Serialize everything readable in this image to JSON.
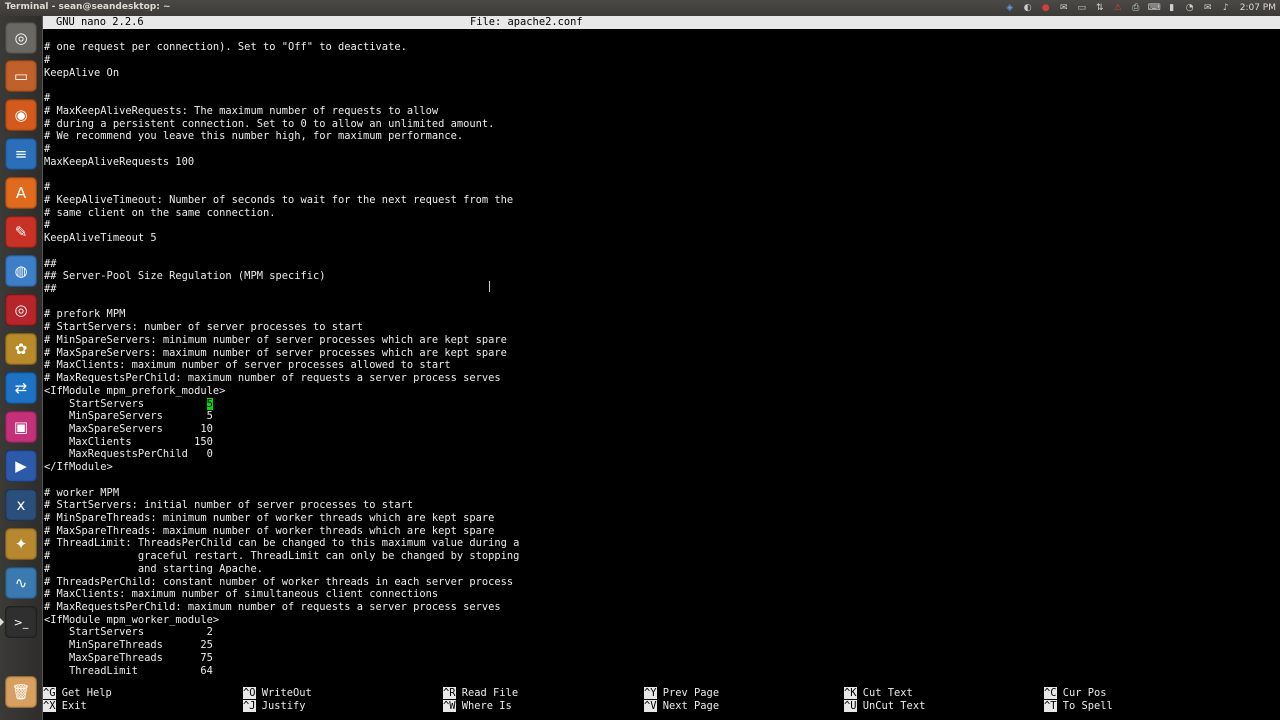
{
  "panel": {
    "window_title": "Terminal - sean@seandesktop: ~",
    "clock": "2:07 PM",
    "tray_icons": [
      "dropbox-icon",
      "notify-icon",
      "chat-icon",
      "mail-icon",
      "display-icon",
      "network-icon",
      "alert-icon",
      "printer-icon",
      "keyboard-icon",
      "battery-icon",
      "chat-bubble-icon",
      "mail-envelope-icon",
      "volume-icon"
    ]
  },
  "launcher": {
    "items": [
      {
        "name": "dash-icon",
        "bg": "#6a6862",
        "glyph": "◎"
      },
      {
        "name": "files-icon",
        "bg": "#c0602a",
        "glyph": "▭"
      },
      {
        "name": "firefox-icon",
        "bg": "#d35a1c",
        "glyph": "◉"
      },
      {
        "name": "writer-icon",
        "bg": "#2b6fb8",
        "glyph": "≡"
      },
      {
        "name": "software-center-icon",
        "bg": "#e06a1e",
        "glyph": "A"
      },
      {
        "name": "editor-icon",
        "bg": "#c83226",
        "glyph": "✎"
      },
      {
        "name": "chromium-icon",
        "bg": "#3d7ec8",
        "glyph": "◍"
      },
      {
        "name": "disc-burner-icon",
        "bg": "#b5252a",
        "glyph": "◎"
      },
      {
        "name": "games-icon",
        "bg": "#b88a2a",
        "glyph": "✿"
      },
      {
        "name": "teamviewer-icon",
        "bg": "#1e72c4",
        "glyph": "⇄"
      },
      {
        "name": "camera-icon",
        "bg": "#c4307a",
        "glyph": "▣"
      },
      {
        "name": "media-player-icon",
        "bg": "#2d5aa8",
        "glyph": "▶"
      },
      {
        "name": "xbmc-icon",
        "bg": "#2a4f7a",
        "glyph": "x"
      },
      {
        "name": "paint-icon",
        "bg": "#b88830",
        "glyph": "✦"
      },
      {
        "name": "system-monitor-icon",
        "bg": "#3a7ab0",
        "glyph": "∿"
      },
      {
        "name": "terminal-icon",
        "bg": "#2f2f2f",
        "glyph": ">_"
      },
      {
        "name": "trash-icon",
        "bg": "#d8a060",
        "glyph": "🗑"
      }
    ]
  },
  "nano": {
    "version": "GNU nano 2.2.6",
    "file_label": "File: apache2.conf",
    "lines": [
      "# one request per connection). Set to \"Off\" to deactivate.",
      "#",
      "KeepAlive On",
      "",
      "#",
      "# MaxKeepAliveRequests: The maximum number of requests to allow",
      "# during a persistent connection. Set to 0 to allow an unlimited amount.",
      "# We recommend you leave this number high, for maximum performance.",
      "#",
      "MaxKeepAliveRequests 100",
      "",
      "#",
      "# KeepAliveTimeout: Number of seconds to wait for the next request from the",
      "# same client on the same connection.",
      "#",
      "KeepAliveTimeout 5",
      "",
      "##",
      "## Server-Pool Size Regulation (MPM specific)",
      "##",
      "",
      "# prefork MPM",
      "# StartServers: number of server processes to start",
      "# MinSpareServers: minimum number of server processes which are kept spare",
      "# MaxSpareServers: maximum number of server processes which are kept spare",
      "# MaxClients: maximum number of server processes allowed to start",
      "# MaxRequestsPerChild: maximum number of requests a server process serves",
      "<IfModule mpm_prefork_module>",
      "    StartServers          5",
      "    MinSpareServers       5",
      "    MaxSpareServers      10",
      "    MaxClients          150",
      "    MaxRequestsPerChild   0",
      "</IfModule>",
      "",
      "# worker MPM",
      "# StartServers: initial number of server processes to start",
      "# MinSpareThreads: minimum number of worker threads which are kept spare",
      "# MaxSpareThreads: maximum number of worker threads which are kept spare",
      "# ThreadLimit: ThreadsPerChild can be changed to this maximum value during a",
      "#              graceful restart. ThreadLimit can only be changed by stopping",
      "#              and starting Apache.",
      "# ThreadsPerChild: constant number of worker threads in each server process",
      "# MaxClients: maximum number of simultaneous client connections",
      "# MaxRequestsPerChild: maximum number of requests a server process serves",
      "<IfModule mpm_worker_module>",
      "    StartServers          2",
      "    MinSpareThreads      25",
      "    MaxSpareThreads      75",
      "    ThreadLimit          64"
    ],
    "cursor_line": 28,
    "cursor_col": 26,
    "shortcuts": [
      {
        "key": "^G",
        "label": "Get Help"
      },
      {
        "key": "^O",
        "label": "WriteOut"
      },
      {
        "key": "^R",
        "label": "Read File"
      },
      {
        "key": "^Y",
        "label": "Prev Page"
      },
      {
        "key": "^K",
        "label": "Cut Text"
      },
      {
        "key": "^C",
        "label": "Cur Pos"
      },
      {
        "key": "^X",
        "label": "Exit"
      },
      {
        "key": "^J",
        "label": "Justify"
      },
      {
        "key": "^W",
        "label": "Where Is"
      },
      {
        "key": "^V",
        "label": "Next Page"
      },
      {
        "key": "^U",
        "label": "UnCut Text"
      },
      {
        "key": "^T",
        "label": "To Spell"
      }
    ]
  }
}
